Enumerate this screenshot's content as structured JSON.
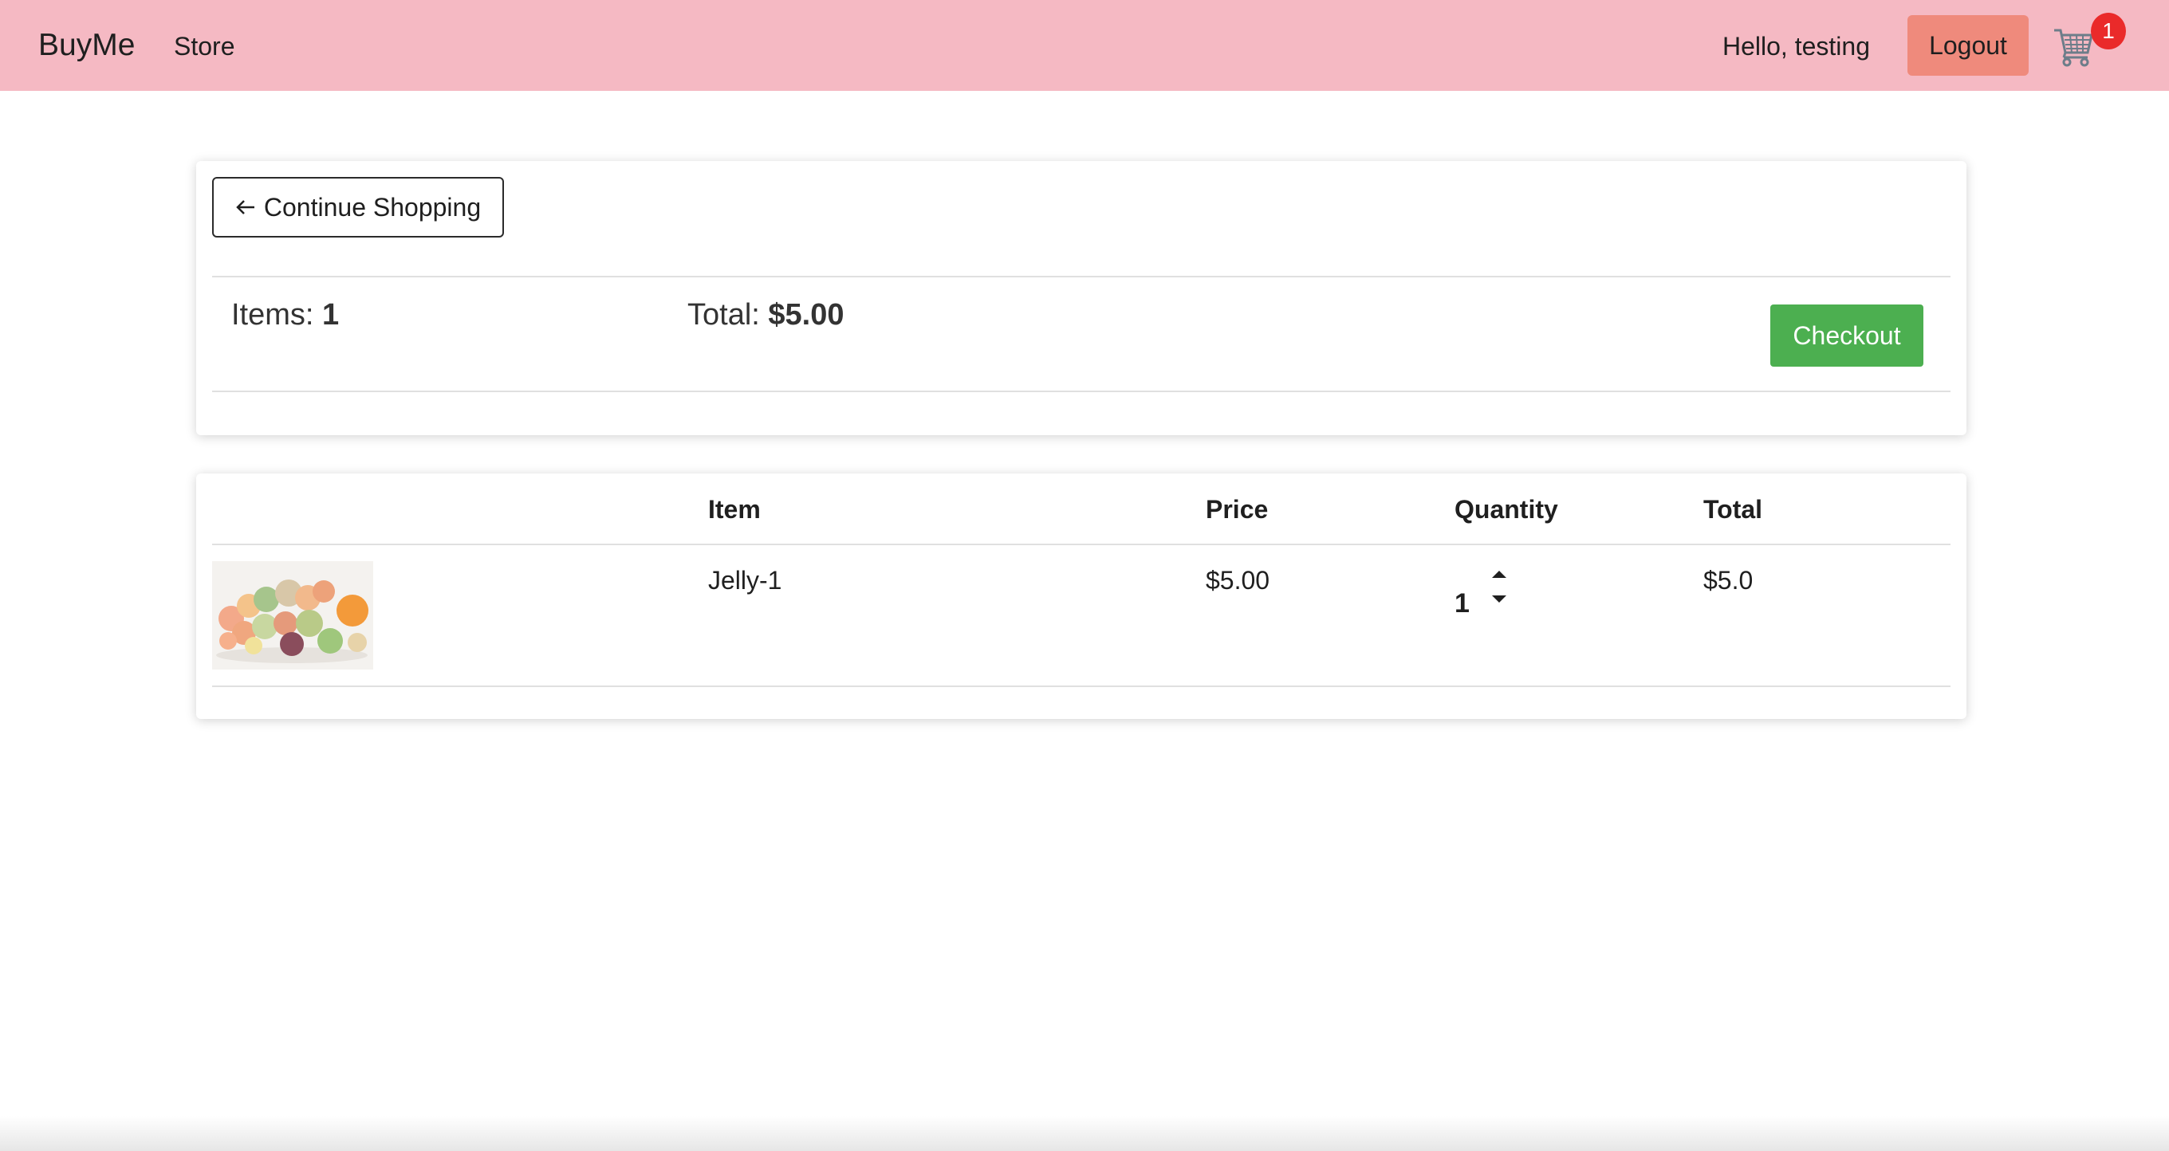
{
  "navbar": {
    "brand": "BuyMe",
    "store_link": "Store",
    "greeting": "Hello, testing",
    "logout_label": "Logout",
    "cart_icon": "cart-icon",
    "cart_count": "1",
    "background": "#f5b9c3",
    "logout_color": "#ef8a7c",
    "badge_color": "#ea2a2a"
  },
  "summary": {
    "continue_label": "Continue Shopping",
    "continue_icon": "arrow-left-icon",
    "items_label": "Items: ",
    "items_value": "1",
    "total_label": "Total: ",
    "total_value": "$5.00",
    "checkout_label": "Checkout",
    "checkout_color": "#4caf50"
  },
  "cart_table": {
    "headers": [
      "Item",
      "Price",
      "Quantity",
      "Total"
    ],
    "rows": [
      {
        "image": "candy-thumbnail",
        "name": "Jelly-1",
        "price": "$5.00",
        "quantity": "1",
        "total": "$5.0"
      }
    ]
  }
}
